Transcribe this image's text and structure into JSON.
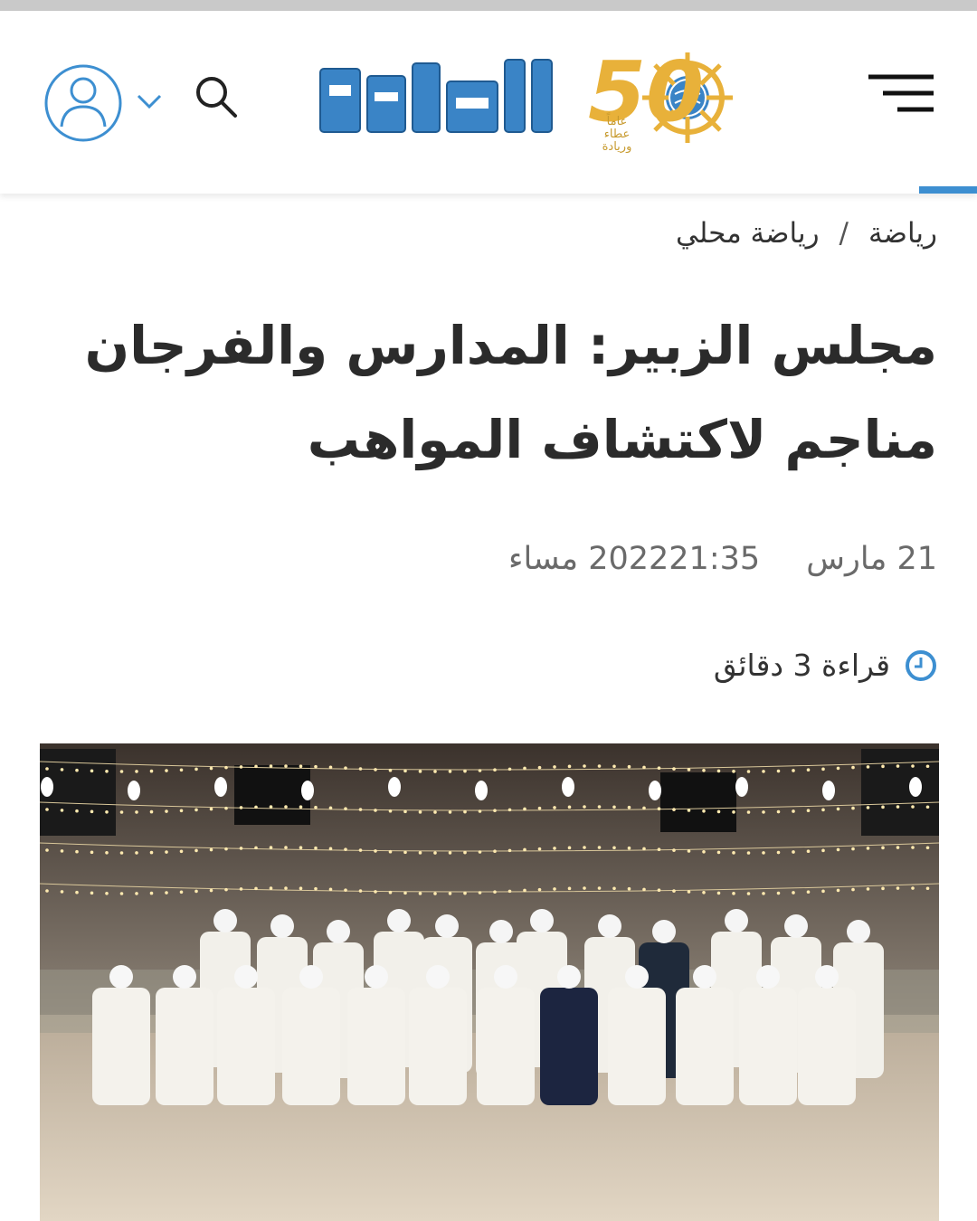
{
  "header": {
    "logo_text": "الخليج",
    "logo_badge_number": "50",
    "logo_badge_caption": "عاماً عطاء وريادة",
    "menu_icon": "hamburger-menu-icon",
    "search_icon": "search-icon",
    "account_icon": "user-avatar-icon",
    "accent_color": "#3d8fd1"
  },
  "breadcrumb": {
    "items": [
      "رياضة",
      "رياضة محلي"
    ],
    "separator": "/"
  },
  "article": {
    "title_line1": "مجلس الزبير: المدارس والفرجان",
    "title_line2": "مناجم لاكتشاف المواهب",
    "date": "21 مارس 2022",
    "time": "21:35 مساء",
    "read_time": "قراءة 3 دقائق",
    "image_description_icon": "photo"
  }
}
